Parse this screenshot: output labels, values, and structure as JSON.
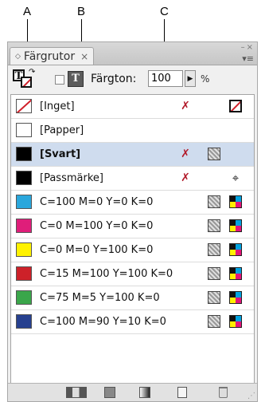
{
  "callouts": [
    "A",
    "B",
    "C"
  ],
  "panel": {
    "tab_title": "Färgrutor",
    "tab_arrows_icon": "◇",
    "tab_close_icon": "×",
    "window_controls": "–×",
    "menu_icon": "▾≡"
  },
  "toolbar": {
    "fill_stroke_icon": "T",
    "format_icon": "T",
    "tint_label": "Färgton:",
    "tint_value": "100",
    "tint_arrow_icon": "▶",
    "percent": "%"
  },
  "swatches": [
    {
      "name": "[Inget]",
      "color": "#ffffff",
      "kind": "none",
      "noedit": true,
      "selected": false
    },
    {
      "name": "[Papper]",
      "color": "#ffffff",
      "kind": "plain",
      "noedit": false,
      "selected": false
    },
    {
      "name": "[Svart]",
      "color": "#000000",
      "kind": "spot",
      "noedit": true,
      "selected": true
    },
    {
      "name": "[Passmärke]",
      "color": "#000000",
      "kind": "registration",
      "noedit": true,
      "selected": false
    },
    {
      "name": "C=100 M=0 Y=0 K=0",
      "color": "#2aa7dc",
      "kind": "cmyk",
      "noedit": false,
      "selected": false
    },
    {
      "name": "C=0 M=100 Y=0 K=0",
      "color": "#df1e7a",
      "kind": "cmyk",
      "noedit": false,
      "selected": false
    },
    {
      "name": "C=0 M=0 Y=100 K=0",
      "color": "#fff200",
      "kind": "cmyk",
      "noedit": false,
      "selected": false
    },
    {
      "name": "C=15 M=100 Y=100 K=0",
      "color": "#cd2129",
      "kind": "cmyk",
      "noedit": false,
      "selected": false
    },
    {
      "name": "C=75 M=5 Y=100 K=0",
      "color": "#3aa64a",
      "kind": "cmyk",
      "noedit": false,
      "selected": false
    },
    {
      "name": "C=100 M=90 Y=10 K=0",
      "color": "#26408f",
      "kind": "cmyk",
      "noedit": false,
      "selected": false
    }
  ],
  "icons": {
    "noedit": "✗",
    "registration": "⌖"
  },
  "colors": {
    "selected_row": "#cfdcee",
    "panel_bg": "#f0f0f0"
  }
}
